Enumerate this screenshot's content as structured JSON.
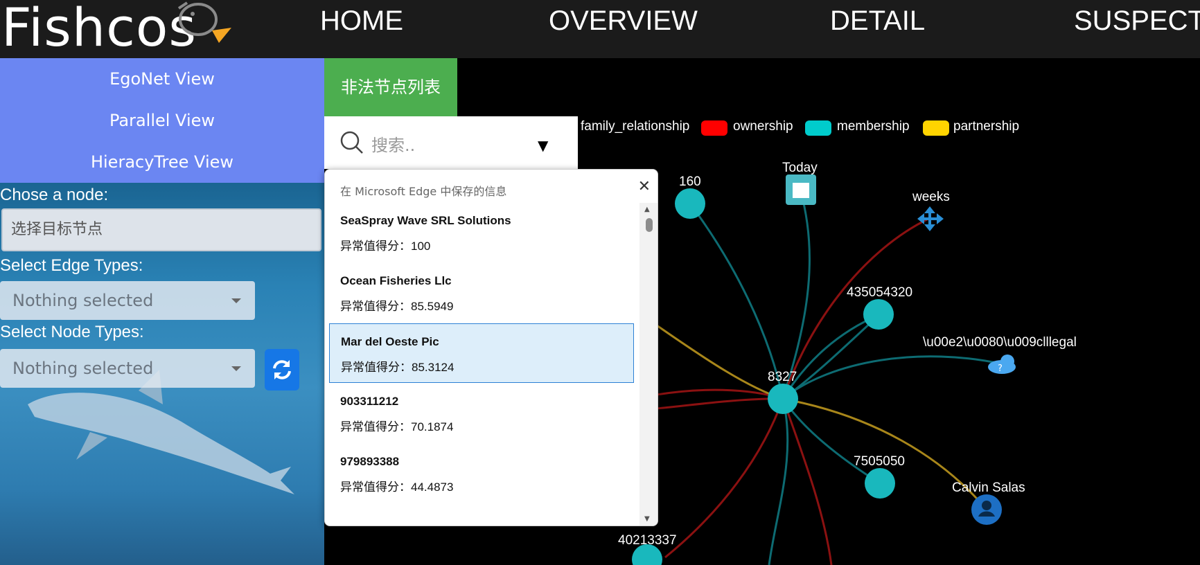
{
  "app": {
    "logo": "Fishcos"
  },
  "nav": {
    "home": "HOME",
    "overview": "OVERVIEW",
    "detail": "DETAIL",
    "suspect": "SUSPECT"
  },
  "views": [
    "EgoNet View",
    "Parallel View",
    "HieracyTree View"
  ],
  "form": {
    "chose_node_label": "Chose a node:",
    "node_placeholder": "选择目标节点",
    "edge_types_label": "Select Edge Types:",
    "edge_types_value": "Nothing selected",
    "node_types_label": "Select Node Types:",
    "node_types_value": "Nothing selected"
  },
  "illegal_list_button": "非法节点列表",
  "search": {
    "placeholder": "搜索.."
  },
  "autofill_popup": {
    "title": "在 Microsoft Edge 中保存的信息",
    "items": [
      {
        "name": "SeaSpray Wave SRL Solutions",
        "score": "异常值得分：100"
      },
      {
        "name": "Ocean Fisheries Llc",
        "score": "异常值得分：85.5949"
      },
      {
        "name": "Mar del Oeste Pic",
        "score": "异常值得分：85.3124"
      },
      {
        "name": "903311212",
        "score": "异常值得分：70.1874"
      },
      {
        "name": "979893388",
        "score": "异常值得分：44.4873"
      }
    ]
  },
  "legend": [
    {
      "label": "family_relationship",
      "color": ""
    },
    {
      "label": "ownership",
      "color": "#ff0000"
    },
    {
      "label": "membership",
      "color": "#00cccc"
    },
    {
      "label": "partnership",
      "color": "#ffd400"
    }
  ],
  "graph": {
    "nodes": [
      "160",
      "Today",
      "weeks",
      "435054320",
      "\\u00e2\\u0080\\u009clllegal",
      "8327",
      "7505050",
      "Calvin Salas",
      "40213337"
    ]
  },
  "colors": {
    "membership_edge": "#0d6b72",
    "ownership_edge": "#8b1111",
    "partnership_edge": "#a8861a",
    "node_teal": "#19b8bd",
    "view_button_bg": "#6b86f2",
    "illegal_button_bg": "#4cae4f"
  }
}
